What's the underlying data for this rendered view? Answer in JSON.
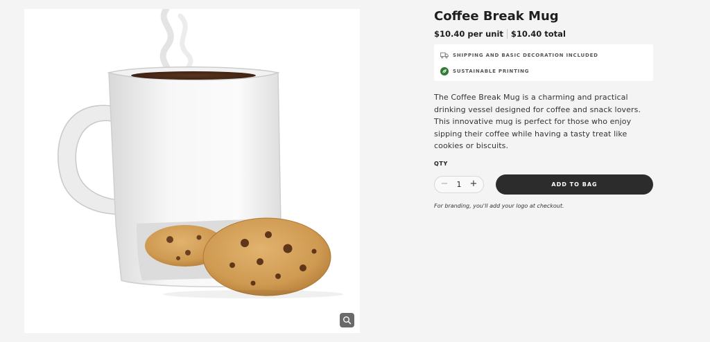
{
  "product": {
    "image_alt": "Coffee Break Mug with cookies",
    "title": "Coffee Break Mug",
    "unit_price": "$10.40 per unit",
    "total_price": "$10.40 total",
    "perks": [
      {
        "icon": "truck-icon",
        "label": "SHIPPING AND BASIC DECORATION INCLUDED"
      },
      {
        "icon": "leaf-icon",
        "label": "SUSTAINABLE PRINTING"
      }
    ],
    "description": "The Coffee Break Mug is a charming and practical drinking vessel designed for coffee and snack lovers. This innovative mug is perfect for those who enjoy sipping their coffee while having a tasty treat like cookies or biscuits.",
    "qty_label": "QTY",
    "quantity": "1",
    "decrement_symbol": "−",
    "increment_symbol": "+",
    "add_to_bag_label": "ADD TO BAG",
    "branding_note": "For branding, you'll add your logo at checkout."
  },
  "zoom_icon": "magnifier-icon",
  "colors": {
    "page_background": "#f4f4f4",
    "button_dark": "#2c2c2c",
    "leaf_green": "#2e7d32"
  }
}
